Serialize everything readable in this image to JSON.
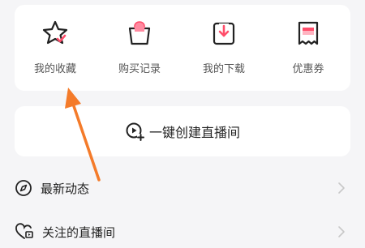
{
  "shortcuts": [
    {
      "label": "我的收藏",
      "icon": "star-icon"
    },
    {
      "label": "购买记录",
      "icon": "shopping-bag-icon"
    },
    {
      "label": "我的下载",
      "icon": "download-icon"
    },
    {
      "label": "优惠券",
      "icon": "coupon-icon"
    }
  ],
  "live": {
    "label": "一键创建直播间",
    "icon": "create-live-icon"
  },
  "menu": [
    {
      "label": "最新动态",
      "icon": "compass-icon"
    },
    {
      "label": "关注的直播间",
      "icon": "heart-live-icon"
    }
  ],
  "colors": {
    "accent": "#ff4d6a",
    "arrow": "#f47b2a"
  }
}
